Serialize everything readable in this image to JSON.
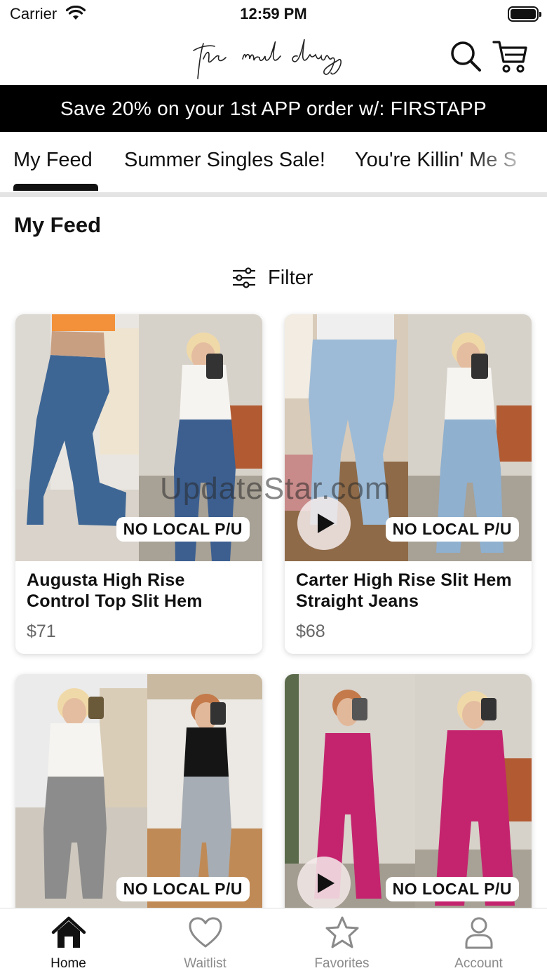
{
  "status": {
    "carrier": "Carrier",
    "time": "12:59 PM"
  },
  "header": {
    "logo_text": "the mud dress"
  },
  "promo": {
    "text": "Save 20% on your 1st APP order w/: FIRSTAPP"
  },
  "tabs": [
    {
      "label": "My Feed",
      "active": true
    },
    {
      "label": "Summer Singles Sale!"
    },
    {
      "label": "You're Killin' Me S"
    }
  ],
  "section": {
    "title": "My Feed"
  },
  "filter": {
    "label": "Filter",
    "icon": "sliders-icon"
  },
  "products": [
    {
      "title": "Augusta High Rise Control Top Slit Hem",
      "price": "$71",
      "badge": "NO LOCAL P/U",
      "has_video": false
    },
    {
      "title": "Carter High Rise Slit Hem Straight Jeans",
      "price": "$68",
      "badge": "NO LOCAL P/U",
      "has_video": true
    },
    {
      "title": "",
      "price": "",
      "badge": "NO LOCAL P/U",
      "has_video": false
    },
    {
      "title": "",
      "price": "",
      "badge": "NO LOCAL P/U",
      "has_video": true
    }
  ],
  "watermark": "UpdateStar.com",
  "bottom_nav": [
    {
      "label": "Home",
      "icon": "home-icon",
      "active": true
    },
    {
      "label": "Waitlist",
      "icon": "heart-icon"
    },
    {
      "label": "Favorites",
      "icon": "star-icon"
    },
    {
      "label": "Account",
      "icon": "user-icon"
    }
  ],
  "colors": {
    "banner_bg": "#000000",
    "accent": "#111111",
    "inactive": "#8a8a8a",
    "jumpsuit": "#c4246e",
    "denim": "#3e6694"
  }
}
